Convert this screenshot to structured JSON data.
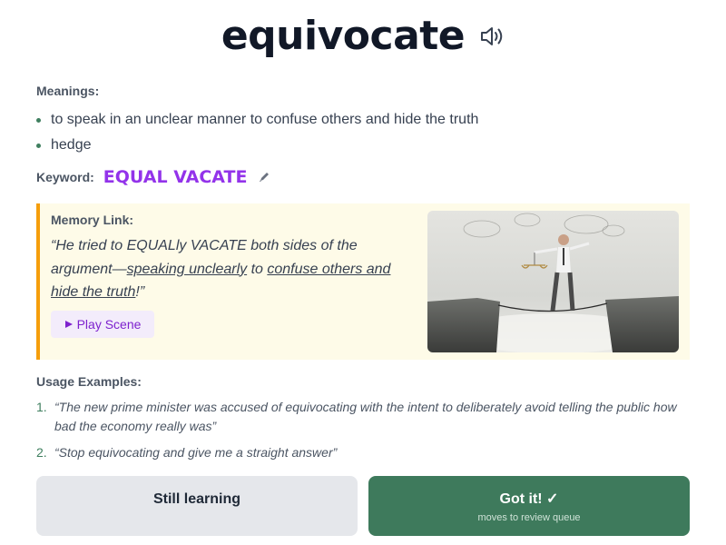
{
  "word": "equivocate",
  "meanings_label": "Meanings:",
  "meanings": [
    "to speak in an unclear manner to confuse others and hide the truth",
    "hedge"
  ],
  "keyword": {
    "label": "Keyword:",
    "value": "EQUAL VACATE"
  },
  "memory": {
    "label": "Memory Link:",
    "quote_parts": [
      "“He tried to EQUALly VACATE both sides of the argument—",
      "speaking unclearly",
      " to ",
      "confuse others and hide the truth",
      "!”"
    ],
    "play_label": "Play Scene"
  },
  "usage": {
    "label": "Usage Examples:",
    "items": [
      {
        "num": "1.",
        "text": "“The new prime minister was accused of equivocating with the intent to deliberately avoid telling the public how bad the economy really was”"
      },
      {
        "num": "2.",
        "text": "“Stop equivocating and give me a straight answer”"
      }
    ]
  },
  "buttons": {
    "still_learning": "Still learning",
    "got_it": "Got it! ✓",
    "got_it_sub": "moves to review queue"
  },
  "colors": {
    "keyword": "#9333ea",
    "memory_bg": "#fefbe8",
    "memory_border": "#f59e0b",
    "got_it_bg": "#3e7a5c",
    "still_bg": "#e5e7eb"
  },
  "icons": {
    "speaker": "speaker-icon",
    "edit": "pencil-icon",
    "play": "play-icon"
  }
}
